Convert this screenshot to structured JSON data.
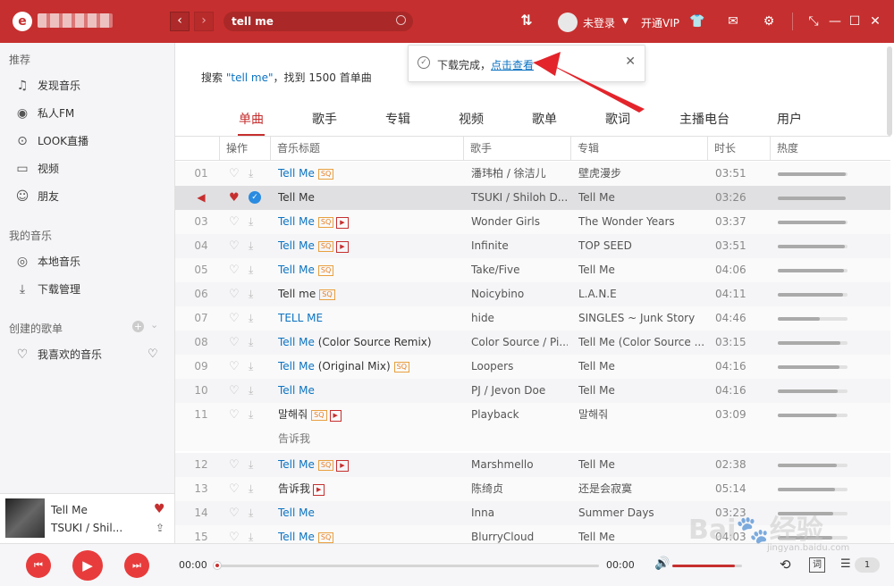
{
  "header": {
    "logo": "e",
    "search_value": "tell me",
    "login": "未登录",
    "vip": "开通VIP"
  },
  "sidebar": {
    "section1": "推荐",
    "items1": [
      "发现音乐",
      "私人FM",
      "LOOK直播",
      "视频",
      "朋友"
    ],
    "section2": "我的音乐",
    "items2": [
      "本地音乐",
      "下载管理"
    ],
    "section3": "创建的歌单",
    "items3": [
      "我喜欢的音乐"
    ]
  },
  "summary": {
    "prefix": "搜索",
    "query": "\"tell me\"",
    "suffix": "，找到 1500 首单曲"
  },
  "tabs": [
    "单曲",
    "歌手",
    "专辑",
    "视频",
    "歌单",
    "歌词",
    "主播电台",
    "用户"
  ],
  "columns": [
    "操作",
    "音乐标题",
    "歌手",
    "专辑",
    "时长",
    "热度"
  ],
  "rows": [
    {
      "no": "01",
      "title": "Tell Me",
      "title_blue": true,
      "tags": [
        "SQ"
      ],
      "artist": "潘玮柏 / 徐洁儿",
      "album": "壁虎漫步",
      "album_blue": false,
      "dur": "03:51",
      "heat": 0.98
    },
    {
      "no": "",
      "title": "Tell Me",
      "title_blue": false,
      "tags": [],
      "artist": "TSUKI / Shiloh D...",
      "album": "Tell Me",
      "album_blue": false,
      "dur": "03:26",
      "heat": 0.98,
      "playing": true
    },
    {
      "no": "03",
      "title": "Tell Me",
      "title_blue": true,
      "tags": [
        "SQ",
        "MV"
      ],
      "artist": "Wonder Girls",
      "album": "The Wonder Years",
      "album_blue": false,
      "dur": "03:37",
      "heat": 0.97
    },
    {
      "no": "04",
      "title": "Tell Me",
      "title_blue": true,
      "tags": [
        "SQ",
        "MV"
      ],
      "artist": "Infinite",
      "album": "TOP SEED",
      "album_blue": false,
      "dur": "03:51",
      "heat": 0.96
    },
    {
      "no": "05",
      "title": "Tell Me",
      "title_blue": true,
      "tags": [
        "SQ"
      ],
      "artist": "Take/Five",
      "album": "Tell Me",
      "album_blue": true,
      "dur": "04:06",
      "heat": 0.95
    },
    {
      "no": "06",
      "title": "Tell me",
      "title_blue": false,
      "tags": [
        "SQ"
      ],
      "artist": "Noicybino",
      "album": "L.A.N.E",
      "album_blue": false,
      "dur": "04:11",
      "heat": 0.94
    },
    {
      "no": "07",
      "title": "TELL ME",
      "title_blue": true,
      "tags": [],
      "artist": "hide",
      "album": "SINGLES ~ Junk Story",
      "album_blue": false,
      "dur": "04:46",
      "heat": 0.6
    },
    {
      "no": "08",
      "title": "Tell Me",
      "title_suffix": " (Color Source Remix)",
      "title_blue": true,
      "tags": [],
      "artist": "Color Source / Pi...",
      "album": "Tell Me (Color Source ...",
      "album_blue": true,
      "dur": "03:15",
      "heat": 0.9
    },
    {
      "no": "09",
      "title": "Tell Me",
      "title_suffix": " (Original Mix)",
      "title_blue": true,
      "tags": [
        "SQ"
      ],
      "artist": "Loopers",
      "album": "Tell Me",
      "album_blue": true,
      "dur": "04:16",
      "heat": 0.88
    },
    {
      "no": "10",
      "title": "Tell Me",
      "title_blue": true,
      "tags": [],
      "artist": "PJ / Jevon Doe",
      "album": "Tell Me",
      "album_blue": true,
      "dur": "04:16",
      "heat": 0.86
    },
    {
      "no": "11",
      "title": "말해줘",
      "title_blue": false,
      "tags": [
        "SQ",
        "MV"
      ],
      "artist": "Playback",
      "album": "말해줘",
      "album_blue": false,
      "dur": "03:09",
      "heat": 0.85,
      "sub": "告诉我"
    },
    {
      "no": "12",
      "title": "Tell Me",
      "title_blue": true,
      "tags": [
        "SQ",
        "MV"
      ],
      "artist": "Marshmello",
      "album": "Tell Me",
      "album_blue": true,
      "dur": "02:38",
      "heat": 0.84
    },
    {
      "no": "13",
      "title": "告诉我",
      "title_blue": false,
      "tags": [
        "MV"
      ],
      "artist": "陈绮贞",
      "album": "还是会寂寞",
      "album_blue": false,
      "dur": "05:14",
      "heat": 0.82
    },
    {
      "no": "14",
      "title": "Tell Me",
      "title_blue": true,
      "tags": [],
      "artist": "Inna",
      "album": "Summer Days",
      "album_blue": false,
      "dur": "03:23",
      "heat": 0.8
    },
    {
      "no": "15",
      "title": "Tell Me",
      "title_blue": true,
      "tags": [
        "SQ"
      ],
      "artist": "BlurryCloud",
      "album": "Tell Me",
      "album_blue": true,
      "dur": "04:03",
      "heat": 0.78
    }
  ],
  "popup": {
    "text": "下载完成，",
    "link": "点击查看"
  },
  "now_playing": {
    "title": "Tell Me",
    "artist": "TSUKI / Shil..."
  },
  "player": {
    "elapsed": "00:00",
    "total": "00:00",
    "playlist_count": "1",
    "lyric_btn": "词",
    "progress": 0,
    "volume": 0.9
  },
  "watermark": {
    "text": "Bai🐾经验",
    "url": "jingyan.baidu.com"
  }
}
